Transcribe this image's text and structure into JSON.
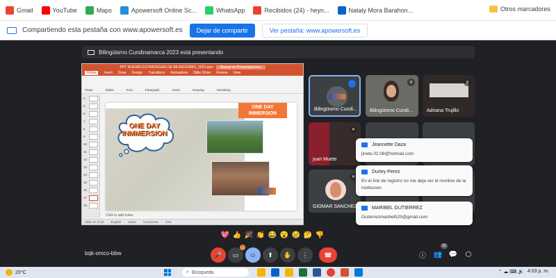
{
  "bookmarks": {
    "items": [
      {
        "label": "Gmail",
        "icon": "gmail-icon",
        "color": "#ea4335"
      },
      {
        "label": "YouTube",
        "icon": "youtube-icon",
        "color": "#ff0000"
      },
      {
        "label": "Maps",
        "icon": "maps-icon",
        "color": "#34a853"
      },
      {
        "label": "Apowersoft Online Sc...",
        "icon": "apowersoft-icon",
        "color": "#2a8bd6"
      },
      {
        "label": "WhatsApp",
        "icon": "whatsapp-icon",
        "color": "#25d366"
      },
      {
        "label": "Recibidos (24) - heyn...",
        "icon": "gmail-icon",
        "color": "#ea4335"
      },
      {
        "label": "Nataly Mora Barahon...",
        "icon": "outlook-icon",
        "color": "#0a64c8"
      }
    ],
    "other": "Otros marcadores"
  },
  "sharebar": {
    "text": "Compartiendo esta pestaña con www.apowersoft.es",
    "stop": "Dejar de compartir",
    "view": "Ver pestaña: www.apowersoft.es"
  },
  "meet": {
    "presenting": "Bilingüismo Cundinamarca 2023 está presentando",
    "meeting_code": "bqk-omco-bbw",
    "participants": [
      {
        "name": "Bilingüismo Cundi..."
      },
      {
        "name": "Bilingüismo Cundi..."
      },
      {
        "name": "Adriana Trujillo"
      },
      {
        "name": "juan Muete"
      },
      {
        "name": "GIOMAR SANCHEZ"
      }
    ],
    "participant_count": "91",
    "chat": [
      {
        "name": "Jeannette Daza",
        "message": "jinete.02.08@hotmail.com"
      },
      {
        "name": "Durley Perez",
        "message": "En el link de registro no me deja ver el nombre de la institucion"
      },
      {
        "name": "MARIBEL GUTIERREZ",
        "message": "Gutierrezmaribel525@gmail.com"
      }
    ],
    "reactions": [
      "💖",
      "👍",
      "🎉",
      "👏",
      "😂",
      "😮",
      "😢",
      "🤔",
      "👎"
    ],
    "raise_hand_badge": "1"
  },
  "ppt": {
    "title": "PPT NUEVAS ESTRATEGIAS DE BILINGÜISMO_2023.pptx",
    "search": "Buscar en Presentaciones",
    "tabs": [
      "Home",
      "Insert",
      "Draw",
      "Design",
      "Transitions",
      "Animations",
      "Slide Show",
      "Review",
      "View"
    ],
    "ribbon": [
      "Paste",
      "Slides",
      "Font",
      "Paragraph",
      "Insert",
      "Drawing",
      "Sensitivity"
    ],
    "slide_numbers": [
      "4",
      "5",
      "6",
      "7",
      "8",
      "9",
      "10",
      "11",
      "12",
      "13",
      "14",
      "15",
      "16",
      "17",
      "18"
    ],
    "banner": "ONE DAY IMMERSION",
    "cloud_text": "ONE DAY INMMERSION",
    "notes": "Click to add notes",
    "status": [
      "Slide 17 of 22",
      "English",
      "Notes",
      "Comments",
      "43%"
    ]
  },
  "taskbar": {
    "temperature": "20°C",
    "search": "Búsqueda",
    "time": "4:03 p. m."
  }
}
